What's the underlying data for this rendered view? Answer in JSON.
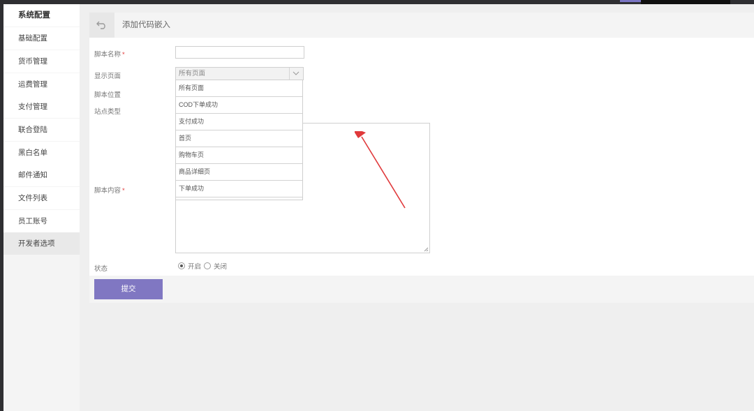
{
  "sidebar": {
    "items": [
      {
        "label": "系统配置"
      },
      {
        "label": "基础配置"
      },
      {
        "label": "货币管理"
      },
      {
        "label": "运费管理"
      },
      {
        "label": "支付管理"
      },
      {
        "label": "联合登陆"
      },
      {
        "label": "黑白名单"
      },
      {
        "label": "邮件通知"
      },
      {
        "label": "文件列表"
      },
      {
        "label": "员工账号"
      },
      {
        "label": "开发者选项"
      }
    ]
  },
  "header": {
    "title": "添加代码嵌入",
    "back_icon": "undo-arrow-icon"
  },
  "form": {
    "script_name_label": "脚本名称",
    "required_mark": "*",
    "display_page_label": "显示页面",
    "display_page_value": "所有页面",
    "script_position_label": "脚本位置",
    "site_type_label": "站点类型",
    "script_content_label": "脚本内容",
    "status_label": "状态",
    "status_on": "开启",
    "status_off": "关闭",
    "status_selected": "开启",
    "submit_label": "提交"
  },
  "dropdown": {
    "options": [
      "所有页面",
      "COD下单成功",
      "支付成功",
      "首页",
      "购物车页",
      "商品详细页",
      "下单成功"
    ]
  },
  "colors": {
    "accent": "#8077c2",
    "annotation_arrow": "#e0393b",
    "topbar": "#2f2f32"
  }
}
